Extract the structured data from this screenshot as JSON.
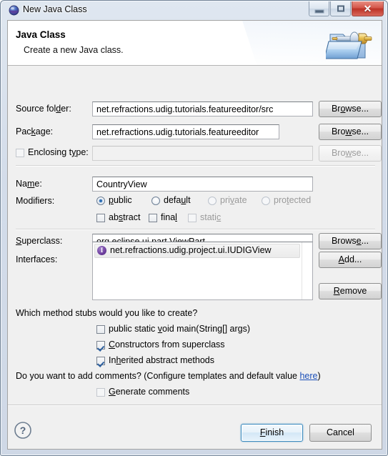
{
  "window": {
    "title": "New Java Class",
    "icon": "java-class-icon",
    "controls": {
      "minimize": "–",
      "maximize": "□",
      "close": "✕"
    }
  },
  "banner": {
    "title": "Java Class",
    "description": "Create a new Java class.",
    "icon": "new-java-class-banner-icon"
  },
  "fields": {
    "source_folder": {
      "label_before": "Source fol",
      "label_mnemonic": "d",
      "label_after": "er:",
      "value": "net.refractions.udig.tutorials.featureeditor/src",
      "placeholder": ""
    },
    "package": {
      "label_before": "Pac",
      "label_mnemonic": "k",
      "label_after": "age:",
      "value": "net.refractions.udig.tutorials.featureeditor",
      "placeholder": ""
    },
    "enclosing_type": {
      "label_before": "Enclosing t",
      "label_mnemonic": "y",
      "label_after": "pe:",
      "value": "",
      "placeholder": "",
      "checked": false,
      "enabled": false
    },
    "name": {
      "label_before": "Na",
      "label_mnemonic": "m",
      "label_after": "e:",
      "value": "CountryView",
      "placeholder": ""
    },
    "superclass": {
      "label_before": "",
      "label_mnemonic": "S",
      "label_after": "uperclass:",
      "value": "org.eclipse.ui.part.ViewPart",
      "placeholder": ""
    },
    "interfaces": {
      "label": "Interfaces:",
      "items": [
        {
          "icon": "interface-icon",
          "icon_glyph": "I",
          "text": "net.refractions.udig.project.ui.IUDIGView"
        }
      ]
    }
  },
  "buttons": {
    "browse_source_folder": {
      "before": "Br",
      "mnemonic": "o",
      "after": "wse...",
      "enabled": true
    },
    "browse_package": {
      "before": "Bro",
      "mnemonic": "w",
      "after": "se...",
      "enabled": true
    },
    "browse_enclosing_type": {
      "before": "Bro",
      "mnemonic": "w",
      "after": "se...",
      "enabled": false
    },
    "browse_superclass": {
      "before": "Brows",
      "mnemonic": "e",
      "after": "...",
      "enabled": true
    },
    "add_interface": {
      "before": "",
      "mnemonic": "A",
      "after": "dd...",
      "enabled": true
    },
    "remove_interface": {
      "before": "",
      "mnemonic": "R",
      "after": "emove",
      "enabled": true
    }
  },
  "modifiers": {
    "label": "Modifiers:",
    "radios": [
      {
        "before": "",
        "mnemonic": "p",
        "after": "ublic",
        "selected": true,
        "enabled": true
      },
      {
        "before": "defa",
        "mnemonic": "u",
        "after": "lt",
        "selected": false,
        "enabled": true
      },
      {
        "before": "pri",
        "mnemonic": "v",
        "after": "ate",
        "selected": false,
        "enabled": false
      },
      {
        "before": "pro",
        "mnemonic": "t",
        "after": "ected",
        "selected": false,
        "enabled": false
      }
    ],
    "checkboxes": [
      {
        "before": "ab",
        "mnemonic": "s",
        "after": "tract",
        "checked": false,
        "enabled": true
      },
      {
        "before": "fina",
        "mnemonic": "l",
        "after": "",
        "checked": false,
        "enabled": true
      },
      {
        "before": "stati",
        "mnemonic": "c",
        "after": "",
        "checked": false,
        "enabled": false
      }
    ]
  },
  "stubs": {
    "question": "Which method stubs would you like to create?",
    "options": [
      {
        "before": "public static ",
        "mnemonic": "v",
        "after": "oid main(String[] args)",
        "checked": false,
        "enabled": true
      },
      {
        "before": "",
        "mnemonic": "C",
        "after": "onstructors from superclass",
        "checked": true,
        "enabled": true
      },
      {
        "before": "In",
        "mnemonic": "h",
        "after": "erited abstract methods",
        "checked": true,
        "enabled": true
      }
    ]
  },
  "comments": {
    "question_before": "Do you want to add comments? (Configure templates and default value ",
    "link": "here",
    "question_after": ")",
    "checkbox": {
      "before": "",
      "mnemonic": "G",
      "after": "enerate comments",
      "checked": false,
      "enabled": true
    }
  },
  "footer": {
    "help_icon": "help-question-icon",
    "finish": {
      "before": "",
      "mnemonic": "F",
      "after": "inish",
      "default": true
    },
    "cancel": {
      "before": "Cancel",
      "mnemonic": "",
      "after": ""
    }
  },
  "colors": {
    "accent": "#3c8bbf",
    "link": "#1b4fb8",
    "interface_icon": "#6f3f9f",
    "close_button": "#bc3327",
    "dialog_bg": "#f0f0f0"
  }
}
